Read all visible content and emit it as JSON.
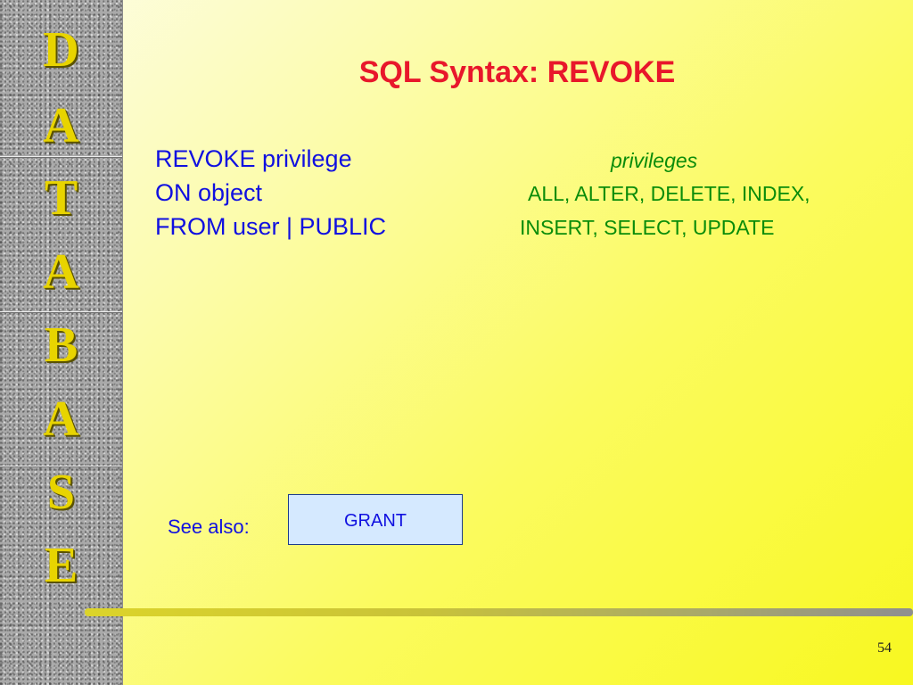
{
  "sidebar": {
    "letters": [
      "D",
      "A",
      "T",
      "A",
      "B",
      "A",
      "S",
      "E"
    ]
  },
  "slide": {
    "title": "SQL Syntax: REVOKE",
    "syntax_lines": [
      "REVOKE privilege",
      "ON object",
      "FROM user | PUBLIC"
    ],
    "privileges_heading": "privileges",
    "privileges_lines": [
      "ALL, ALTER, DELETE, INDEX,",
      "INSERT, SELECT, UPDATE"
    ],
    "see_also_label": "See also:",
    "grant_button_label": "GRANT",
    "page_number": "54"
  },
  "colors": {
    "title": "#e8172b",
    "syntax_text": "#1010e0",
    "privileges_text": "#0a8c0a",
    "sidebar_letters": "#e8d400",
    "grant_box_fill": "#d5e9ff"
  }
}
